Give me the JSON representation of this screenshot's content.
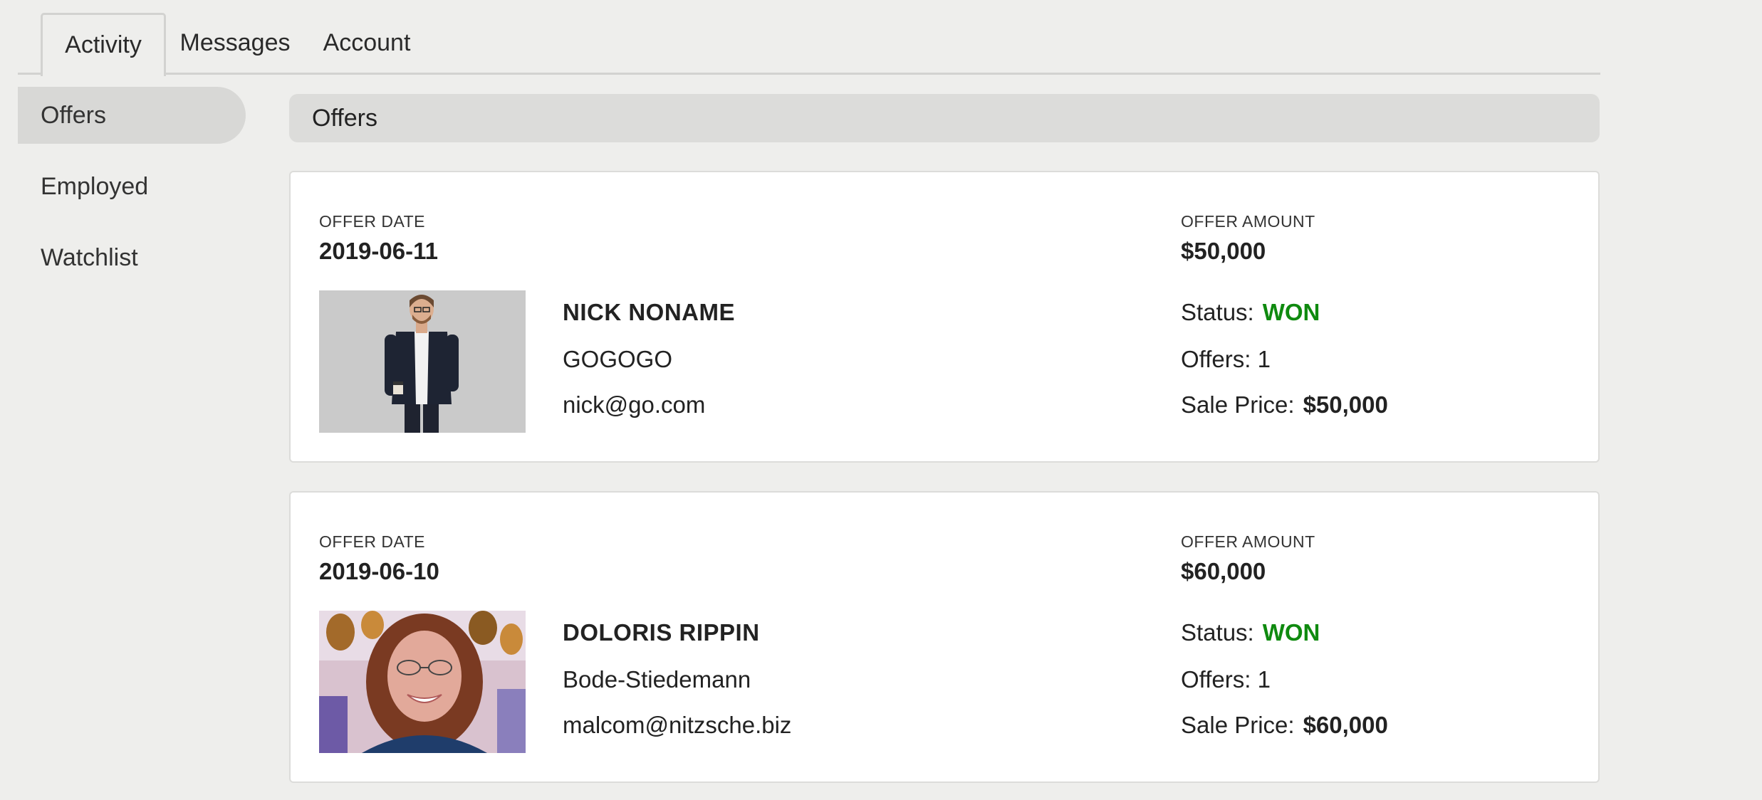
{
  "tabs": [
    {
      "label": "Activity",
      "active": true
    },
    {
      "label": "Messages",
      "active": false
    },
    {
      "label": "Account",
      "active": false
    }
  ],
  "sidebar": {
    "items": [
      {
        "label": "Offers",
        "active": true
      },
      {
        "label": "Employed",
        "active": false
      },
      {
        "label": "Watchlist",
        "active": false
      }
    ]
  },
  "section_title": "Offers",
  "offers": [
    {
      "date_label": "OFFER DATE",
      "date": "2019-06-11",
      "amount_label": "OFFER AMOUNT",
      "amount": "$50,000",
      "name": "NICK NONAME",
      "company": "GOGOGO",
      "email": "nick@go.com",
      "status_label": "Status:",
      "status": "WON",
      "offers_text": "Offers: 1",
      "sale_price_label": "Sale Price:",
      "sale_price": "$50,000"
    },
    {
      "date_label": "OFFER DATE",
      "date": "2019-06-10",
      "amount_label": "OFFER AMOUNT",
      "amount": "$60,000",
      "name": "DOLORIS RIPPIN",
      "company": "Bode-Stiedemann",
      "email": "malcom@nitzsche.biz",
      "status_label": "Status:",
      "status": "WON",
      "offers_text": "Offers: 1",
      "sale_price_label": "Sale Price:",
      "sale_price": "$60,000"
    }
  ],
  "colors": {
    "won": "#0f8a0f",
    "page_bg": "#eeeeec",
    "active_sidebar": "#d8d8d6"
  }
}
